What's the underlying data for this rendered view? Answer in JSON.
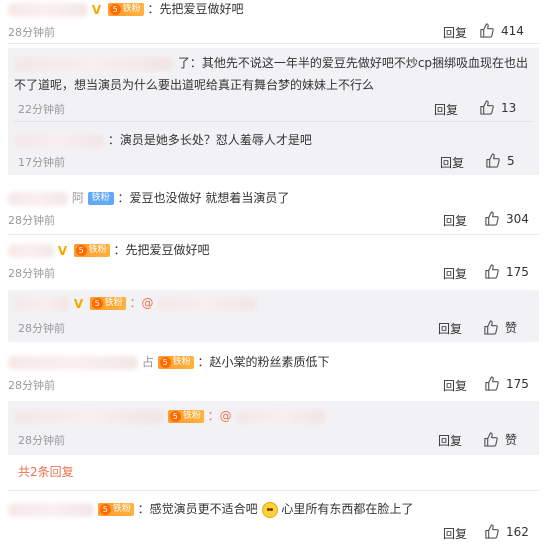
{
  "icons": {
    "like": "thumbs-up-icon",
    "vip": "vip-v-icon",
    "fan_badge": "fan-badge-icon",
    "emoji": "face-emoji-icon"
  },
  "colors": {
    "accent": "#eb7350",
    "badge_orange": "#ff9a2e",
    "badge_blue": "#61a8f5",
    "muted": "#999999"
  },
  "badges": {
    "fan": "铁粉",
    "iron": "铁粉"
  },
  "comments": [
    {
      "text": "：先把爱豆做好吧",
      "time": "28分钟前",
      "reply": "回复",
      "likes": "414"
    },
    {
      "text": "了：其他先不说这一年半的爱豆先做好吧不炒cp捆绑吸血现在也出不了道呢，想当演员为什么要出道呢给真正有舞台梦的妹妹上不行么",
      "time": "22分钟前",
      "reply": "回复",
      "likes": "13"
    },
    {
      "text": "：演员是她多长处？怼人羞辱人才是吧",
      "time": "17分钟前",
      "reply": "回复",
      "likes": "5"
    },
    {
      "text": "：爱豆也没做好 就想着当演员了",
      "prefix": "阿",
      "time": "28分钟前",
      "reply": "回复",
      "likes": "304"
    },
    {
      "text": "：先把爱豆做好吧",
      "time": "28分钟前",
      "reply": "回复",
      "likes": "175"
    },
    {
      "text": "：@",
      "time": "28分钟前",
      "reply": "回复",
      "likes": "赞"
    },
    {
      "text": "：赵小棠的粉丝素质低下",
      "prefix": "占",
      "time": "28分钟前",
      "reply": "回复",
      "likes": "175"
    },
    {
      "text": "：@",
      "time": "28分钟前",
      "reply": "回复",
      "likes": "赞"
    },
    {
      "text_a": "：感觉演员更不适合吧",
      "text_b": "心里所有东西都在脸上了",
      "time": "",
      "reply": "回复",
      "likes": "162"
    }
  ],
  "more_replies": "共2条回复"
}
